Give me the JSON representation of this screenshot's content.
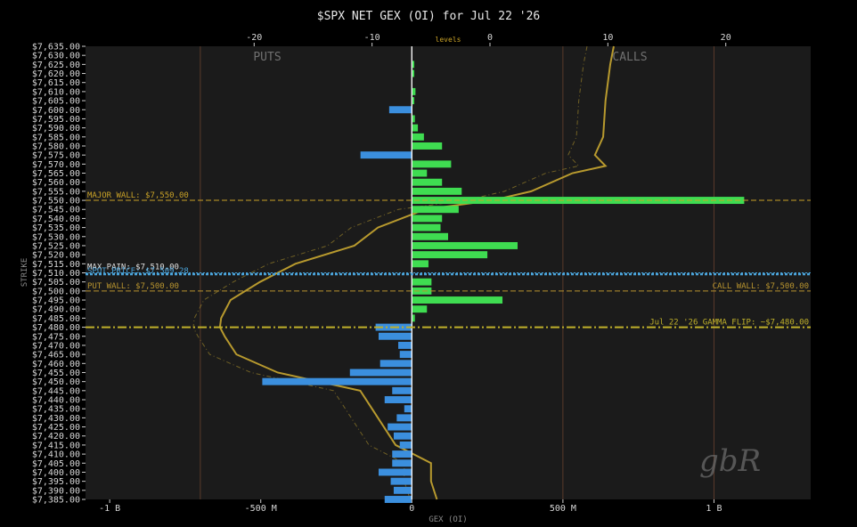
{
  "chart_data": {
    "type": "bar",
    "title": "$SPX NET GEX (OI) for Jul 22 '26",
    "xlabel": "GEX (OI)",
    "ylabel": "STRIKE",
    "orientation": "horizontal",
    "grid": false,
    "xlim_millions": [
      -1080,
      1320
    ],
    "bottom_ticks": [
      {
        "label": "-1 B",
        "value": -1000
      },
      {
        "label": "-500 M",
        "value": -500
      },
      {
        "label": "0",
        "value": 0
      },
      {
        "label": "500 M",
        "value": 500
      },
      {
        "label": "1 B",
        "value": 1000
      }
    ],
    "top_axis_label": "levels",
    "top_ticks": [
      {
        "label": "-20",
        "value": -20
      },
      {
        "label": "-10",
        "value": -10
      },
      {
        "label": "0",
        "value": 0
      },
      {
        "label": "10",
        "value": 10
      },
      {
        "label": "20",
        "value": 20
      }
    ],
    "top_xlim": [
      -34.3,
      27.2
    ],
    "region_labels": {
      "puts": "PUTS",
      "calls": "CALLS"
    },
    "strikes": [
      7635,
      7630,
      7625,
      7620,
      7615,
      7610,
      7605,
      7600,
      7595,
      7590,
      7585,
      7580,
      7575,
      7570,
      7565,
      7560,
      7555,
      7550,
      7545,
      7540,
      7535,
      7530,
      7525,
      7520,
      7515,
      7510,
      7505,
      7500,
      7495,
      7490,
      7485,
      7480,
      7475,
      7470,
      7465,
      7460,
      7455,
      7450,
      7445,
      7440,
      7435,
      7430,
      7425,
      7420,
      7415,
      7410,
      7405,
      7400,
      7395,
      7390,
      7385
    ],
    "strike_labels": [
      "$7,635.00",
      "$7,630.00",
      "$7,625.00",
      "$7,620.00",
      "$7,615.00",
      "$7,610.00",
      "$7,605.00",
      "$7,600.00",
      "$7,595.00",
      "$7,590.00",
      "$7,585.00",
      "$7,580.00",
      "$7,575.00",
      "$7,570.00",
      "$7,565.00",
      "$7,560.00",
      "$7,555.00",
      "$7,550.00",
      "$7,545.00",
      "$7,540.00",
      "$7,535.00",
      "$7,530.00",
      "$7,525.00",
      "$7,520.00",
      "$7,515.00",
      "$7,510.00",
      "$7,505.00",
      "$7,500.00",
      "$7,495.00",
      "$7,490.00",
      "$7,485.00",
      "$7,480.00",
      "$7,475.00",
      "$7,470.00",
      "$7,465.00",
      "$7,460.00",
      "$7,455.00",
      "$7,450.00",
      "$7,445.00",
      "$7,440.00",
      "$7,435.00",
      "$7,430.00",
      "$7,425.00",
      "$7,420.00",
      "$7,415.00",
      "$7,410.00",
      "$7,405.00",
      "$7,400.00",
      "$7,395.00",
      "$7,390.00",
      "$7,385.00"
    ],
    "values_millions": [
      0,
      0,
      8,
      8,
      0,
      12,
      8,
      -75,
      10,
      20,
      40,
      100,
      -170,
      130,
      50,
      100,
      165,
      1100,
      155,
      100,
      95,
      120,
      350,
      250,
      55,
      0,
      65,
      65,
      300,
      50,
      10,
      -120,
      -110,
      -45,
      -40,
      -105,
      -205,
      -495,
      -65,
      -90,
      -25,
      -50,
      -80,
      -60,
      -40,
      -65,
      -65,
      -110,
      -70,
      -60,
      -90
    ],
    "annotations": {
      "major_wall": {
        "label": "MAJOR WALL: $7,550.00",
        "strike": 7550
      },
      "max_pain": {
        "label": "MAX PAIN: $7,510.00",
        "strike": 7510
      },
      "spot_price": {
        "label": "SPOT PRICE: $7,509.28",
        "strike": 7509.28
      },
      "put_wall": {
        "label": "PUT WALL: $7,500.00",
        "strike": 7500
      },
      "call_wall": {
        "label": "CALL WALL: $7,500.00",
        "strike": 7500
      },
      "gamma_flip": {
        "label": "Jul 22 '26 GAMMA FLIP: ~$7,480.00",
        "strike": 7480
      }
    },
    "line_levels_strikes": [
      7635,
      7625,
      7615,
      7605,
      7595,
      7585,
      7575,
      7569,
      7565,
      7555,
      7550,
      7545,
      7535,
      7525,
      7515,
      7510,
      7505,
      7495,
      7485,
      7480,
      7475,
      7465,
      7455,
      7445,
      7435,
      7425,
      7415,
      7405,
      7395,
      7385
    ],
    "line_levels_values": [
      10.5,
      10.2,
      10.0,
      9.8,
      9.7,
      9.6,
      8.9,
      9.8,
      7.0,
      3.5,
      0.2,
      -5.5,
      -9.5,
      -11.5,
      -16.5,
      -18.0,
      -19.5,
      -22.0,
      -22.8,
      -22.9,
      -22.5,
      -21.5,
      -18.0,
      -11.0,
      -10.0,
      -9.0,
      -8.0,
      -5.0,
      -5.0,
      -4.5
    ],
    "colors": {
      "positive": "#3fdc51",
      "negative": "#3b8fde",
      "zero_line": "#f5f5f5",
      "levels_line": "#b89a2e",
      "major_wall": "#c9a227",
      "put_wall": "#b8942f",
      "spot_price": "#4aa3d9",
      "gamma_flip": "#bfb02a",
      "panel": "#1b1b1b"
    }
  },
  "watermark": "gbR"
}
